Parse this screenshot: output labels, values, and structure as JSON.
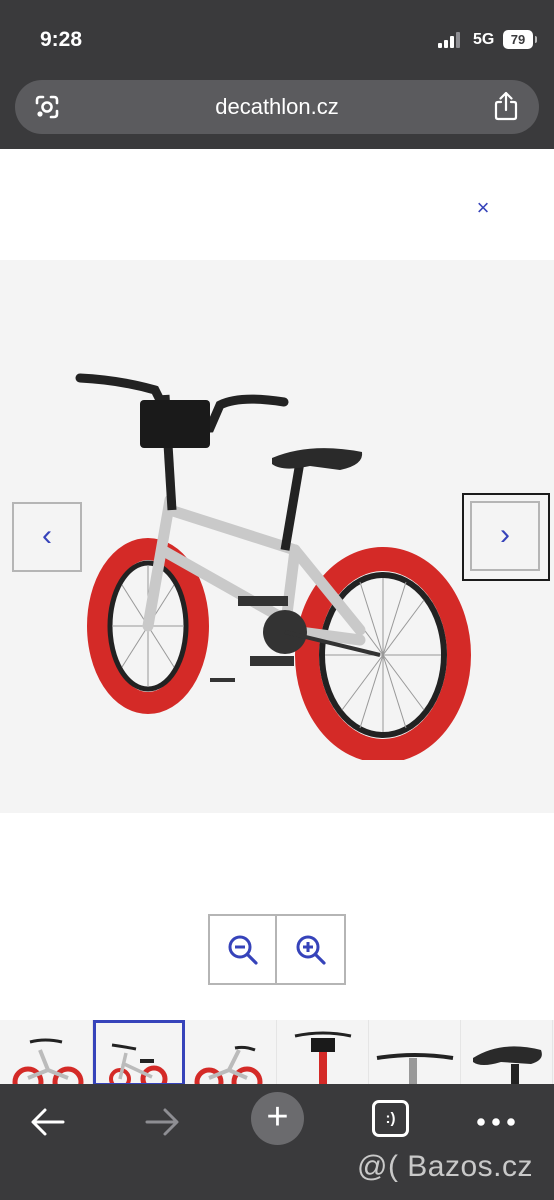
{
  "status_bar": {
    "time": "9:28",
    "network": "5G",
    "battery": "79"
  },
  "browser": {
    "url": "decathlon.cz"
  },
  "gallery": {
    "close_symbol": "×",
    "prev_symbol": "‹",
    "next_symbol": "›",
    "selected_thumbnail_index": 1,
    "thumbnail_count": 6
  },
  "toolbar": {
    "tab_label": ":)"
  },
  "watermark": "@( Bazos.cz",
  "colors": {
    "accent": "#3643ba",
    "tire": "#d42a27",
    "frame": "#c9c9c9",
    "chrome": "#3a3a3c"
  }
}
